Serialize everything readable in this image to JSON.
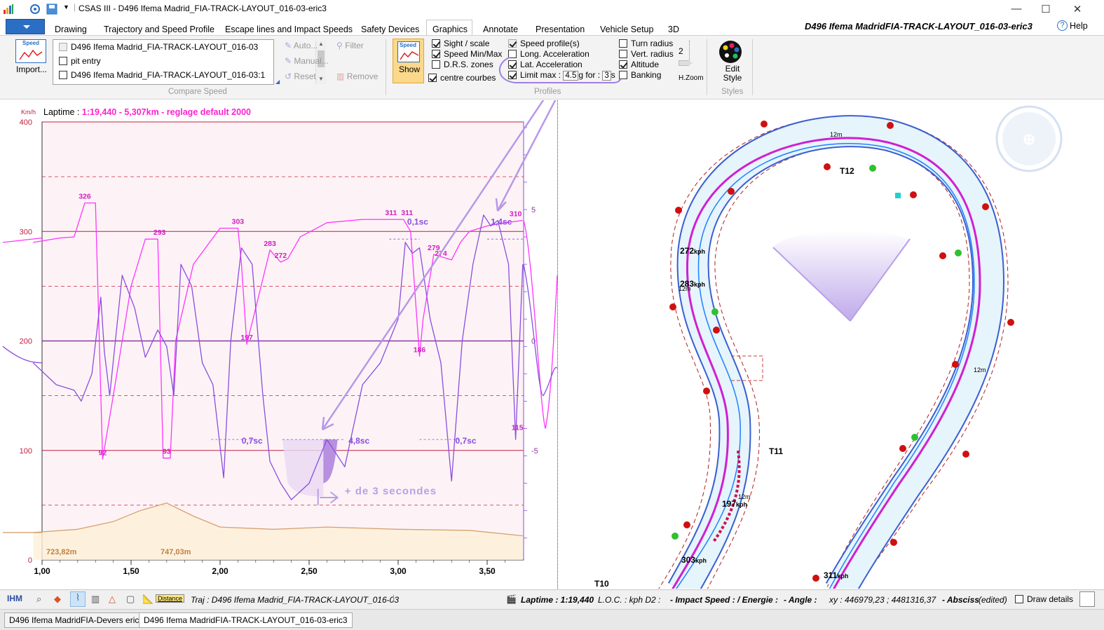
{
  "window": {
    "title": "CSAS III - D496 Ifema Madrid_FIA-TRACK-LAYOUT_016-03-eric3",
    "doc_title": "D496 Ifema MadridFIA-TRACK-LAYOUT_016-03-eric3",
    "help_label": "Help"
  },
  "menu": {
    "tabs": [
      "Drawing",
      "Trajectory and Speed Profile",
      "Escape lines and Impact Speeds",
      "Safety Devices",
      "Graphics",
      "Annotate",
      "Presentation",
      "Vehicle Setup",
      "3D"
    ],
    "active": "Graphics"
  },
  "ribbon": {
    "import_label": "Import...",
    "import_icon_label": "Speed",
    "compare_items": [
      {
        "label": "D496 Ifema Madrid_FIA-TRACK-LAYOUT_016-03",
        "checked": false,
        "disabled": true
      },
      {
        "label": "pit entry",
        "checked": false,
        "disabled": false
      },
      {
        "label": "D496 Ifema Madrid_FIA-TRACK-LAYOUT_016-03:1",
        "checked": false,
        "disabled": false
      }
    ],
    "auto_label": "Auto...",
    "manual_label": "Manual...",
    "reset_label": "Reset",
    "filter_label": "Filter",
    "remove_label": "Remove",
    "compare_group": "Compare Speed",
    "show_label": "Show",
    "show_icon_label": "Speed",
    "col1": [
      {
        "label": "Sight / scale",
        "checked": true
      },
      {
        "label": "Speed Min/Max",
        "checked": true
      },
      {
        "label": "D.R.S. zones",
        "checked": false
      },
      {
        "label": "centre courbes",
        "checked": true
      }
    ],
    "col2": [
      {
        "label": "Speed profile(s)",
        "checked": true
      },
      {
        "label": "Long. Acceleration",
        "checked": false
      },
      {
        "label": "Lat. Acceleration",
        "checked": true
      }
    ],
    "limit": {
      "label": "Limit max :",
      "checked": true,
      "value": "4.5",
      "unit": "g for :",
      "duration": "3",
      "suffix": "s"
    },
    "col3": [
      {
        "label": "Turn radius",
        "checked": false
      },
      {
        "label": "Vert. radius",
        "checked": false
      },
      {
        "label": "Altitude",
        "checked": true
      },
      {
        "label": "Banking",
        "checked": false
      }
    ],
    "profiles_group": "Profiles",
    "hzoom_value": "2",
    "hzoom_label": "H.Zoom",
    "edit_style_label": "Edit Style",
    "styles_group": "Styles"
  },
  "chart_data": {
    "type": "line",
    "title": "Laptime : 1:19,440 - 5,307km - reglage default 2000",
    "title_prefix": "Laptime :",
    "title_value": "1:19,440 - 5,307km - reglage default 2000",
    "ylabel": "Km/h",
    "xlim": [
      0.95,
      3.7
    ],
    "ylim": [
      0,
      400
    ],
    "y_ticks": [
      0,
      100,
      200,
      300,
      400
    ],
    "x_ticks": [
      "1,00",
      "1,50",
      "2,00",
      "2,50",
      "3,00",
      "3,50"
    ],
    "x_tick_values": [
      1.0,
      1.5,
      2.0,
      2.5,
      3.0,
      3.5
    ],
    "right_ticks": [
      "5",
      "0",
      "-5"
    ],
    "series": [
      {
        "name": "speed",
        "color": "#ff33ff",
        "x": [
          0.95,
          1.1,
          1.18,
          1.24,
          1.3,
          1.34,
          1.4,
          1.5,
          1.58,
          1.65,
          1.68,
          1.72,
          1.75,
          1.85,
          2.0,
          2.1,
          2.12,
          2.15,
          2.2,
          2.28,
          2.34,
          2.38,
          2.45,
          2.6,
          2.8,
          3.03,
          3.07,
          3.12,
          3.14,
          3.2,
          3.3,
          3.35,
          3.4,
          3.5,
          3.6,
          3.7
        ],
        "y": [
          290,
          294,
          295,
          326,
          326,
          92,
          150,
          250,
          293,
          293,
          93,
          93,
          200,
          270,
          303,
          303,
          270,
          197,
          230,
          283,
          272,
          275,
          295,
          308,
          311,
          311,
          300,
          186,
          220,
          279,
          274,
          290,
          300,
          305,
          308,
          310
        ]
      },
      {
        "name": "lat-acceleration",
        "color": "#8a4de0",
        "x": [
          0.95,
          1.08,
          1.18,
          1.22,
          1.28,
          1.33,
          1.35,
          1.38,
          1.45,
          1.52,
          1.58,
          1.65,
          1.7,
          1.74,
          1.78,
          1.84,
          1.9,
          1.96,
          2.02,
          2.06,
          2.12,
          2.18,
          2.24,
          2.28,
          2.34,
          2.4,
          2.5,
          2.6,
          2.7,
          2.8,
          2.9,
          3.0,
          3.04,
          3.08,
          3.12,
          3.18,
          3.24,
          3.3,
          3.36,
          3.42,
          3.48,
          3.52,
          3.56,
          3.62,
          3.66,
          3.7
        ],
        "y": [
          180,
          160,
          155,
          145,
          170,
          240,
          190,
          150,
          260,
          230,
          185,
          210,
          195,
          150,
          270,
          250,
          180,
          160,
          75,
          200,
          285,
          270,
          150,
          90,
          70,
          55,
          70,
          110,
          85,
          160,
          180,
          220,
          290,
          280,
          285,
          220,
          180,
          72,
          200,
          270,
          315,
          305,
          310,
          270,
          110,
          270
        ]
      },
      {
        "name": "altitude",
        "color": "#d8a070",
        "x": [
          0.95,
          1.2,
          1.4,
          1.55,
          1.7,
          1.85,
          2.0,
          2.3,
          2.6,
          3.0,
          3.4,
          3.7
        ],
        "y": [
          25,
          28,
          35,
          45,
          52,
          40,
          30,
          28,
          30,
          28,
          27,
          22
        ]
      }
    ],
    "point_labels": [
      {
        "text": "326",
        "x": 1.24,
        "y": 326
      },
      {
        "text": "92",
        "x": 1.34,
        "y": 92
      },
      {
        "text": "293",
        "x": 1.66,
        "y": 293
      },
      {
        "text": "93",
        "x": 1.7,
        "y": 93
      },
      {
        "text": "303",
        "x": 2.1,
        "y": 303
      },
      {
        "text": "197",
        "x": 2.15,
        "y": 197
      },
      {
        "text": "283",
        "x": 2.28,
        "y": 283
      },
      {
        "text": "272",
        "x": 2.34,
        "y": 272
      },
      {
        "text": "311",
        "x": 2.96,
        "y": 311
      },
      {
        "text": "311",
        "x": 3.05,
        "y": 311
      },
      {
        "text": "186",
        "x": 3.12,
        "y": 186
      },
      {
        "text": "279",
        "x": 3.2,
        "y": 279
      },
      {
        "text": "274",
        "x": 3.24,
        "y": 274
      },
      {
        "text": "310",
        "x": 3.66,
        "y": 310
      },
      {
        "text": "115",
        "x": 3.67,
        "y": 115
      }
    ],
    "duration_labels": [
      {
        "text": "0,1sc",
        "x": 3.11,
        "y": 305
      },
      {
        "text": "1,4sc",
        "x": 3.58,
        "y": 305
      },
      {
        "text": "0,7sc",
        "x": 2.18,
        "y": 105
      },
      {
        "text": "4,8sc",
        "x": 2.78,
        "y": 105
      },
      {
        "text": "0,7sc",
        "x": 3.38,
        "y": 105
      }
    ],
    "annotation": "+ de 3 secondes",
    "altitude_labels": [
      "723,82m",
      "747,03m"
    ]
  },
  "map": {
    "corners": [
      "T10",
      "T11",
      "T12"
    ],
    "speeds": [
      {
        "value": "272",
        "unit": "kph"
      },
      {
        "value": "283",
        "unit": "kph"
      },
      {
        "value": "197",
        "unit": "kph"
      },
      {
        "value": "303",
        "unit": "kph"
      },
      {
        "value": "311",
        "unit": "kph"
      }
    ],
    "distances": [
      "12m",
      "12m",
      "12m",
      "12m"
    ]
  },
  "status": {
    "ihm": "IHM",
    "traj": "Traj :  D496 Ifema Madrid_FIA-TRACK-LAYOUT_016-03",
    "laptime": "Laptime : 1:19,440",
    "loc": "L.O.C. : kph  D2 :",
    "impact": "- Impact Speed :  / Energie :",
    "angle": "- Angle :",
    "xy": "xy : 446979,23 ; 4481316,37",
    "absc": "- Absciss",
    "edited": "(edited)",
    "draw_details": "Draw details",
    "distance_icon": "Distance"
  },
  "doc_tabs": [
    "D496 Ifema MadridFIA-Devers eric",
    "D496 Ifema MadridFIA-TRACK-LAYOUT_016-03-eric3"
  ]
}
